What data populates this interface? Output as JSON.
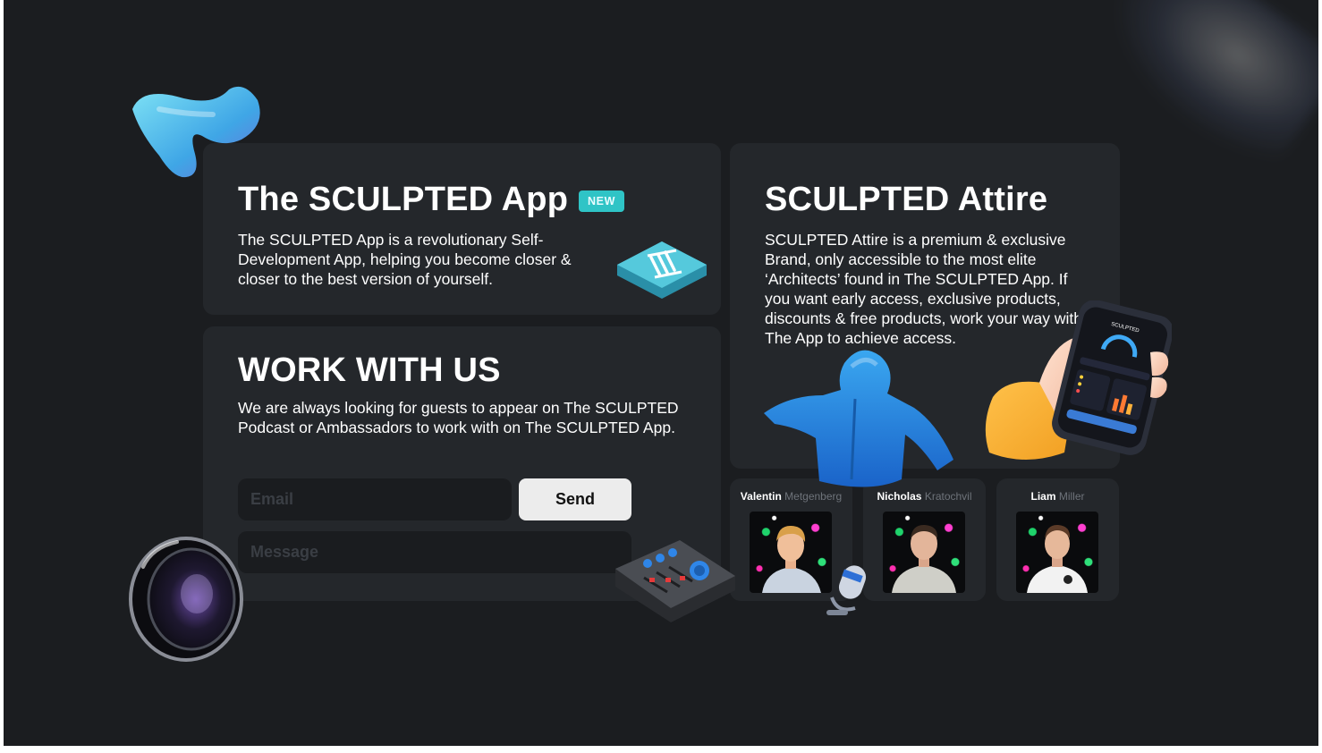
{
  "app_card": {
    "title": "The SCULPTED App",
    "badge": "NEW",
    "description": "The SCULPTED App is a revolutionary Self-Development App, helping you become closer & closer to the best version of yourself."
  },
  "work_card": {
    "title": "WORK WITH US",
    "description": "We are always looking for guests to appear on The SCULPTED Podcast or Ambassadors to work with on The SCULPTED App.",
    "email_placeholder": "Email",
    "message_placeholder": "Message",
    "send_label": "Send"
  },
  "attire_card": {
    "title": "SCULPTED Attire",
    "description": "SCULPTED Attire is a premium & exclusive Brand, only accessible to the most elite ‘Architects’ found in The SCULPTED App. If you want early access, exclusive products, discounts & free products, work your way within The App to achieve access."
  },
  "people": [
    {
      "first": "Valentin",
      "last": "Metgenberg"
    },
    {
      "first": "Nicholas",
      "last": "Kratochvil"
    },
    {
      "first": "Liam",
      "last": "Miller"
    }
  ],
  "phone_mockup": {
    "brand": "SCULPTED"
  },
  "icons": [
    "squiggle-3d-icon",
    "sculpted-logo-tile-icon",
    "hoodie-3d-icon",
    "hand-phone-3d-icon",
    "mixer-3d-icon",
    "microphone-3d-icon",
    "lens-3d-icon"
  ],
  "colors": {
    "background": "#1b1d20",
    "card": "#24272b",
    "badge": "#2fc4c6",
    "input": "#1a1c1f"
  }
}
